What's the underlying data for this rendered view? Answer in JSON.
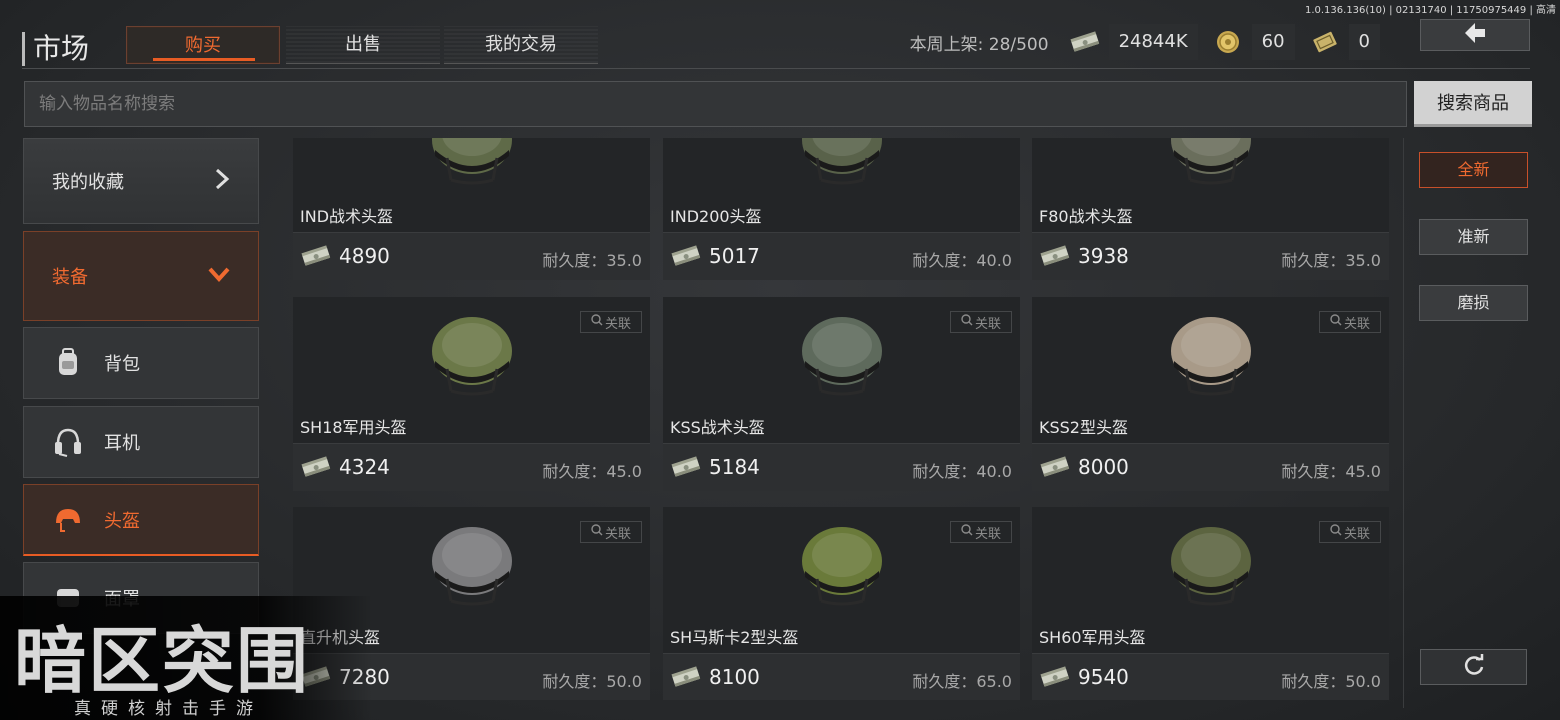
{
  "version": "1.0.136.136(10) | 02131740 | 11750975449 | 高清",
  "header": {
    "title": "市场",
    "tabs": [
      {
        "label": "购买",
        "active": true
      },
      {
        "label": "出售",
        "active": false
      },
      {
        "label": "我的交易",
        "active": false
      }
    ],
    "week_listing_label": "本周上架:",
    "week_listing_value": "28/500",
    "currency_cash": "24844K",
    "currency_coin": "60",
    "currency_ticket": "0",
    "icons": {
      "back": "back-arrow-icon",
      "cash": "cash-stack-icon",
      "coin": "gold-coin-icon",
      "ticket": "ticket-icon"
    }
  },
  "search": {
    "placeholder": "输入物品名称搜索",
    "button_label": "搜索商品"
  },
  "sidebar": {
    "favorites": "我的收藏",
    "equipment": "装备",
    "items": [
      {
        "label": "背包",
        "icon": "backpack-icon"
      },
      {
        "label": "耳机",
        "icon": "headset-icon"
      },
      {
        "label": "头盔",
        "icon": "helmet-icon",
        "active": true
      },
      {
        "label": "面罩",
        "icon": "mask-icon"
      }
    ]
  },
  "items": [
    {
      "name": "IND战术头盔",
      "price": "4890",
      "durability": "耐久度：35.0",
      "color": "#5f6a48"
    },
    {
      "name": "IND200头盔",
      "price": "5017",
      "durability": "耐久度：40.0",
      "color": "#59624a"
    },
    {
      "name": "F80战术头盔",
      "price": "3938",
      "durability": "耐久度：35.0",
      "color": "#6a6e5c"
    },
    {
      "name": "SH18军用头盔",
      "price": "4324",
      "durability": "耐久度：45.0",
      "color": "#6b7848"
    },
    {
      "name": "KSS战术头盔",
      "price": "5184",
      "durability": "耐久度：40.0",
      "color": "#5e6a5c"
    },
    {
      "name": "KSS2型头盔",
      "price": "8000",
      "durability": "耐久度：45.0",
      "color": "#a89a88"
    },
    {
      "name": "直升机头盔",
      "price": "7280",
      "durability": "耐久度：50.0",
      "color": "#7a7a7c"
    },
    {
      "name": "SH马斯卡2型头盔",
      "price": "8100",
      "durability": "耐久度：65.0",
      "color": "#6a7a3a"
    },
    {
      "name": "SH60军用头盔",
      "price": "9540",
      "durability": "耐久度：50.0",
      "color": "#5c6440"
    }
  ],
  "related_label": "关联",
  "filters": [
    "全新",
    "准新",
    "磨损"
  ],
  "logo": {
    "main": "暗区突围",
    "sub": "真硬核射击手游"
  }
}
